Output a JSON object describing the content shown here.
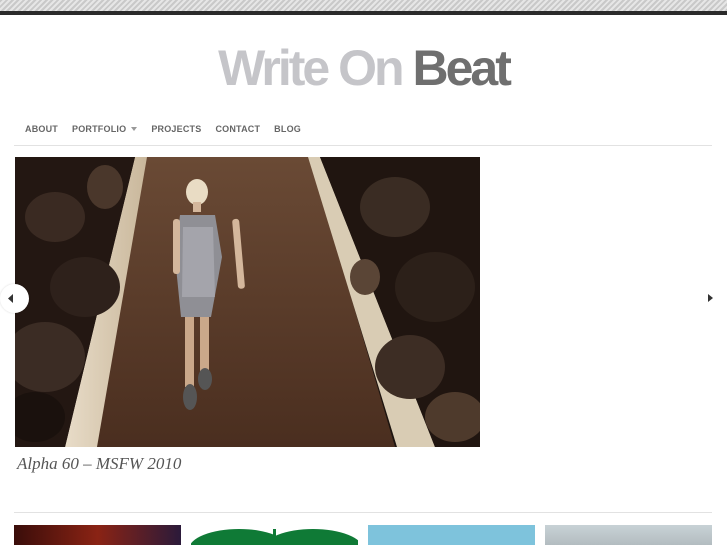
{
  "site": {
    "logo_part1": "Write On",
    "logo_part2": "Beat"
  },
  "nav": {
    "about": "ABOUT",
    "portfolio": "PORTFOLIO",
    "projects": "PROJECTS",
    "contact": "CONTACT",
    "blog": "BLOG"
  },
  "slider": {
    "caption": "Alpha 60 – MSFW 2010"
  },
  "colors": {
    "logo_light": "#c5c5c9",
    "logo_dark": "#6f6f6f",
    "top_bar": "#2b2b2b"
  },
  "icons": {
    "prev": "chevron-left-icon",
    "next": "chevron-right-icon",
    "dropdown": "caret-down-icon"
  }
}
